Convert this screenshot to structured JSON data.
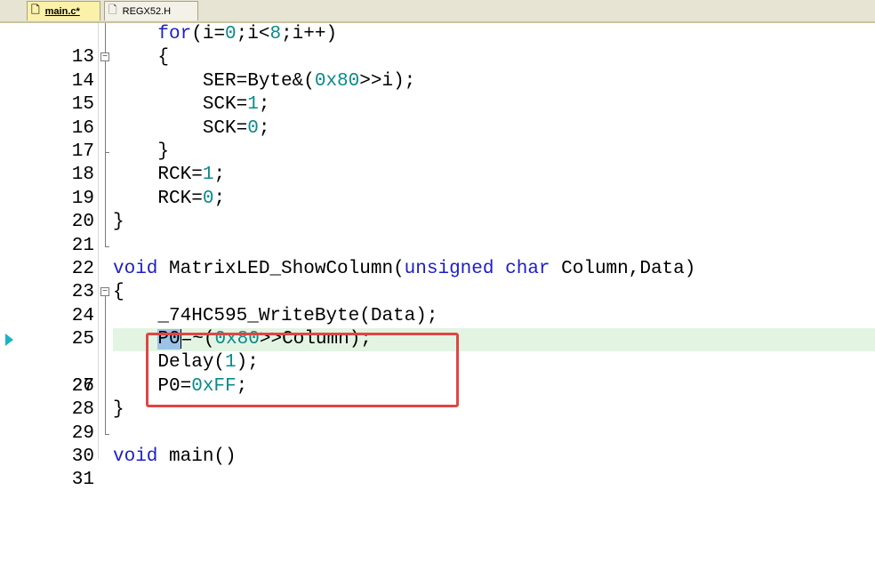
{
  "tabs": [
    {
      "label": "main.c*",
      "icon": "file-icon",
      "active": true
    },
    {
      "label": "REGX52.H",
      "icon": "file-icon",
      "active": false
    }
  ],
  "editor": {
    "current_line": "26",
    "lines": [
      {
        "num": "13",
        "text": "    for(i=0;i<8;i++)"
      },
      {
        "num": "14",
        "text": "    {"
      },
      {
        "num": "15",
        "text": "        SER=Byte&(0x80>>i);"
      },
      {
        "num": "16",
        "text": "        SCK=1;"
      },
      {
        "num": "17",
        "text": "        SCK=0;"
      },
      {
        "num": "18",
        "text": "    }"
      },
      {
        "num": "19",
        "text": "    RCK=1;"
      },
      {
        "num": "20",
        "text": "    RCK=0;"
      },
      {
        "num": "21",
        "text": "}"
      },
      {
        "num": "22",
        "text": ""
      },
      {
        "num": "23",
        "text": "void MatrixLED_ShowColumn(unsigned char Column,Data)"
      },
      {
        "num": "24",
        "text": "{"
      },
      {
        "num": "25",
        "text": "    _74HC595_WriteByte(Data);"
      },
      {
        "num": "26",
        "text": "    P0=~(0x80>>Column);"
      },
      {
        "num": "27",
        "text": "    Delay(1);"
      },
      {
        "num": "28",
        "text": "    P0=0xFF;"
      },
      {
        "num": "29",
        "text": "}"
      },
      {
        "num": "30",
        "text": ""
      },
      {
        "num": "31",
        "text": "void main()"
      }
    ]
  },
  "colors": {
    "keyword": "#1d1dcc",
    "number": "#0a8a8a",
    "highlight": "#e3f4e3",
    "annotation": "#e04545"
  }
}
